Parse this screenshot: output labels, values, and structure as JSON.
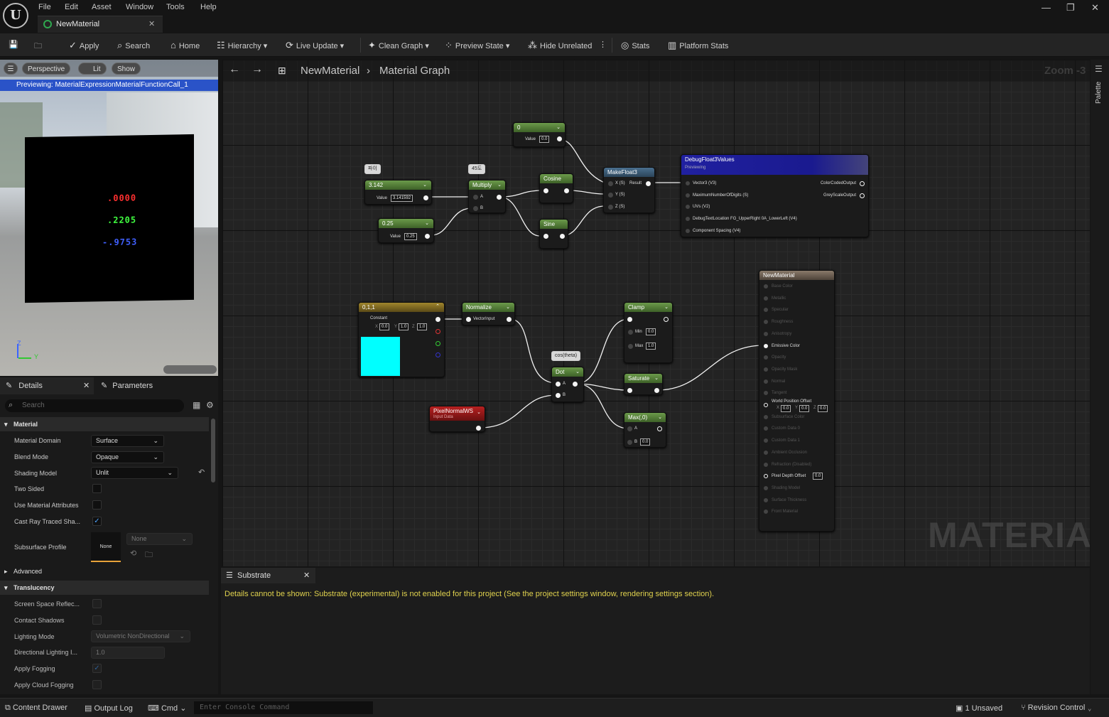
{
  "menu": [
    "File",
    "Edit",
    "Asset",
    "Window",
    "Tools",
    "Help"
  ],
  "doc_tab": "NewMaterial",
  "toolbar": {
    "apply": "Apply",
    "search": "Search",
    "home": "Home",
    "hierarchy": "Hierarchy",
    "live_update": "Live Update",
    "clean_graph": "Clean Graph",
    "preview_state": "Preview State",
    "hide_unrelated": "Hide Unrelated",
    "stats": "Stats",
    "platform_stats": "Platform Stats"
  },
  "viewport": {
    "perspective": "Perspective",
    "lit": "Lit",
    "show": "Show",
    "previewing": "Previewing: MaterialExpressionMaterialFunctionCall_1",
    "values": [
      ".0000",
      ".2205",
      "-.9753"
    ],
    "value_colors": [
      "#ff3030",
      "#40ff40",
      "#4060ff"
    ],
    "axis_z": "Z",
    "axis_y": "Y"
  },
  "details": {
    "tab": "Details",
    "params_tab": "Parameters",
    "search_placeholder": "Search",
    "material_section": "Material",
    "rows": [
      {
        "label": "Material Domain",
        "value": "Surface"
      },
      {
        "label": "Blend Mode",
        "value": "Opaque"
      },
      {
        "label": "Shading Model",
        "value": "Unlit"
      },
      {
        "label": "Two Sided"
      },
      {
        "label": "Use Material Attributes"
      },
      {
        "label": "Cast Ray Traced Sha...",
        "check": "✓"
      },
      {
        "label": "Subsurface Profile",
        "value": "None",
        "thumb": "None"
      }
    ],
    "advanced": "Advanced",
    "translucency_section": "Translucency",
    "trows": [
      {
        "label": "Screen Space Reflec..."
      },
      {
        "label": "Contact Shadows"
      },
      {
        "label": "Lighting Mode",
        "value": "Volumetric NonDirectional"
      },
      {
        "label": "Directional Lighting I...",
        "value": "1.0"
      },
      {
        "label": "Apply Fogging",
        "check": "✓"
      },
      {
        "label": "Apply Cloud Fogging"
      }
    ]
  },
  "graph": {
    "breadcrumb_root": "NewMaterial",
    "breadcrumb_leaf": "Material Graph",
    "zoom": "Zoom -3",
    "watermark": "MATERIAL",
    "nodes": {
      "const0": {
        "title": "0",
        "value_label": "Value",
        "value": "0.0"
      },
      "pi": {
        "title": "3.142",
        "value_label": "Value",
        "value": "3.141592",
        "comment": "파이"
      },
      "c025": {
        "title": "0.25",
        "value_label": "Value",
        "value": "0.25"
      },
      "multiply": {
        "title": "Multiply",
        "a": "A",
        "b": "B",
        "comment": "45도"
      },
      "cosine": {
        "title": "Cosine"
      },
      "sine": {
        "title": "Sine"
      },
      "makefloat3": {
        "title": "MakeFloat3",
        "x": "X (S)",
        "y": "Y (S)",
        "z": "Z (S)",
        "result": "Result"
      },
      "debug": {
        "title": "DebugFloat3Values",
        "subtitle": "Previewing",
        "in1": "Vector3 (V3)",
        "in2": "MaximumNumberOfDigits (S)",
        "in3": "UVs (V2)",
        "in4": "DebugTextLocation FG_UpperRight 0A_LowerLeft (V4)",
        "in5": "Component Spacing (V4)",
        "out1": "ColorCodedOutput",
        "out2": "GreyScaleOutput"
      },
      "const3": {
        "title": "0,1,1",
        "label": "Constant",
        "x": "0.0",
        "y": "1.0",
        "z": "1.0",
        "xl": "X",
        "yl": "Y",
        "zl": "Z",
        "swatch": "#00ffff"
      },
      "normalize": {
        "title": "Normalize",
        "in": "VectorInput"
      },
      "pixelnormal": {
        "title": "PixelNormalWS",
        "subtitle": "Input Data"
      },
      "dot": {
        "title": "Dot",
        "a": "A",
        "b": "B",
        "comment": "cos(theta)"
      },
      "clamp": {
        "title": "Clamp",
        "min": "Min",
        "minv": "0.0",
        "max": "Max",
        "maxv": "1.0"
      },
      "saturate": {
        "title": "Saturate"
      },
      "max": {
        "title": "Max(,0)",
        "a": "A",
        "b": "B",
        "bv": "0.0"
      },
      "material": {
        "title": "NewMaterial",
        "inputs": [
          "Base Color",
          "Metallic",
          "Specular",
          "Roughness",
          "Anisotropy",
          "Emissive Color",
          "Opacity",
          "Opacity Mask",
          "Normal",
          "Tangent",
          "World Position Offset",
          "Subsurface Color",
          "Custom Data 0",
          "Custom Data 1",
          "Ambient Occlusion",
          "Refraction (Disabled)",
          "Pixel Depth Offset",
          "Shading Model",
          "Surface Thickness",
          "Front Material"
        ],
        "wpo": [
          "0.0",
          "0.0",
          "0.0"
        ],
        "wpo_labels": [
          "X",
          "Y",
          "Z"
        ],
        "pdo": "0.0"
      }
    }
  },
  "substrate": {
    "tab": "Substrate",
    "message": "Details cannot be shown: Substrate (experimental) is not enabled for this project (See the project settings window, rendering settings section)."
  },
  "palette": "Palette",
  "status": {
    "content_drawer": "Content Drawer",
    "output_log": "Output Log",
    "cmd": "Cmd",
    "cmd_placeholder": "Enter Console Command",
    "unsaved": "1 Unsaved",
    "revision": "Revision Control"
  }
}
